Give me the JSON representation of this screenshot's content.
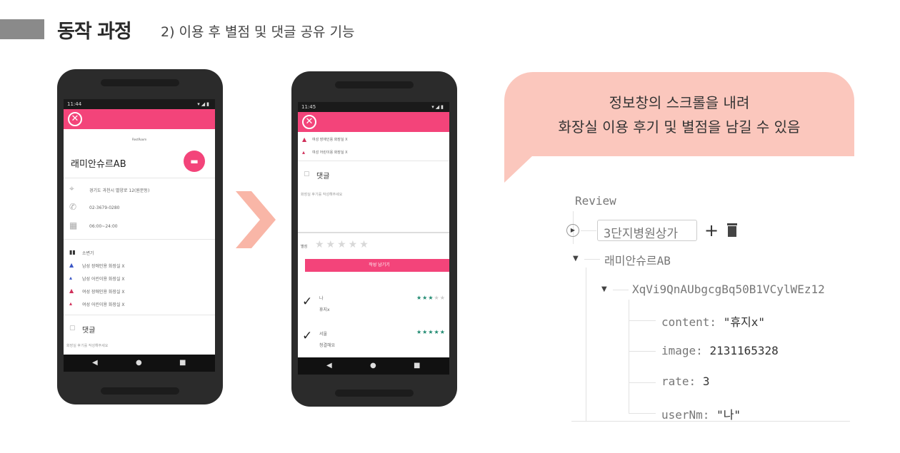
{
  "header": {
    "title": "동작 과정",
    "subtitle": "2) 이용 후 별점 및 댓글 공유 기능"
  },
  "phone1": {
    "status_time": "11:44",
    "logo_text": "RestRoom",
    "place_name": "래미안슈르AB",
    "address": "경기도 과천시 별양로 12(원문동)",
    "phone": "02-3679-0280",
    "hours": "06:00~24:00",
    "facilities": [
      "소변기",
      "남성 장애인용 화장실 X",
      "남성 어린이용 화장실 X",
      "여성 장애인용 화장실 X",
      "여성 어린이용 화장실 X"
    ],
    "comment_label": "댓글",
    "footer_hint": "화장실 후기를 작성해주세요"
  },
  "phone2": {
    "status_time": "11:45",
    "facilities": [
      "여성 장애인용 화장실 X",
      "여성 어린이용 화장실 X"
    ],
    "comment_label": "댓글",
    "comment_placeholder": "화장실 후기를 작성해주세요",
    "rating_label": "별점",
    "submit_label": "작성 남기기",
    "reviews": [
      {
        "user": "나",
        "text": "휴지x",
        "stars": 3
      },
      {
        "user": "서울",
        "text": "청결해요",
        "stars": 5
      }
    ]
  },
  "callout": {
    "line1": "정보창의 스크롤을 내려",
    "line2": "화장실 이용 후기 및 별점을 남길 수 있음"
  },
  "firebase": {
    "root": "Review",
    "node_key": "3단지병원상가",
    "child": "래미안슈르AB",
    "push_id": "XqVi9QnAUbgcgBq50B1VCylWEz12",
    "fields": [
      {
        "key": "content:",
        "value": "\"휴지x\""
      },
      {
        "key": "image:",
        "value": "2131165328"
      },
      {
        "key": "rate:",
        "value": "3"
      },
      {
        "key": "userNm:",
        "value": "\"나\""
      }
    ]
  },
  "colors": {
    "accent_pink": "#f3447a",
    "callout_bg": "#fbc7bd",
    "chevron": "#f9b6a7",
    "phone_body": "#2b2b2b"
  },
  "icons": [
    "close-icon",
    "chat-icon",
    "location-icon",
    "phone-icon",
    "calendar-icon",
    "checkmark-icon",
    "star-icon",
    "chevron-right-icon",
    "add-icon",
    "trash-icon"
  ]
}
